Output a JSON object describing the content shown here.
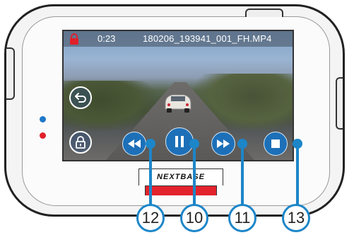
{
  "screen": {
    "status": {
      "time": "0:23",
      "filename": "180206_193941_001_FH.MP4"
    }
  },
  "controls": {
    "back_icon": "back-arrow-icon",
    "lock_icon": "padlock-icon",
    "rewind_icon": "rewind-icon",
    "pause_icon": "pause-icon",
    "forward_icon": "fast-forward-icon",
    "stop_icon": "stop-icon"
  },
  "brand": {
    "name": "NEXTBASE"
  },
  "callouts": {
    "rewind": "12",
    "pause": "10",
    "forward": "11",
    "stop": "13"
  },
  "colors": {
    "accent": "#1d86c8",
    "button_fill": "#1d70b8",
    "lock_red": "#e0202b",
    "brand_red": "#e2232c"
  }
}
